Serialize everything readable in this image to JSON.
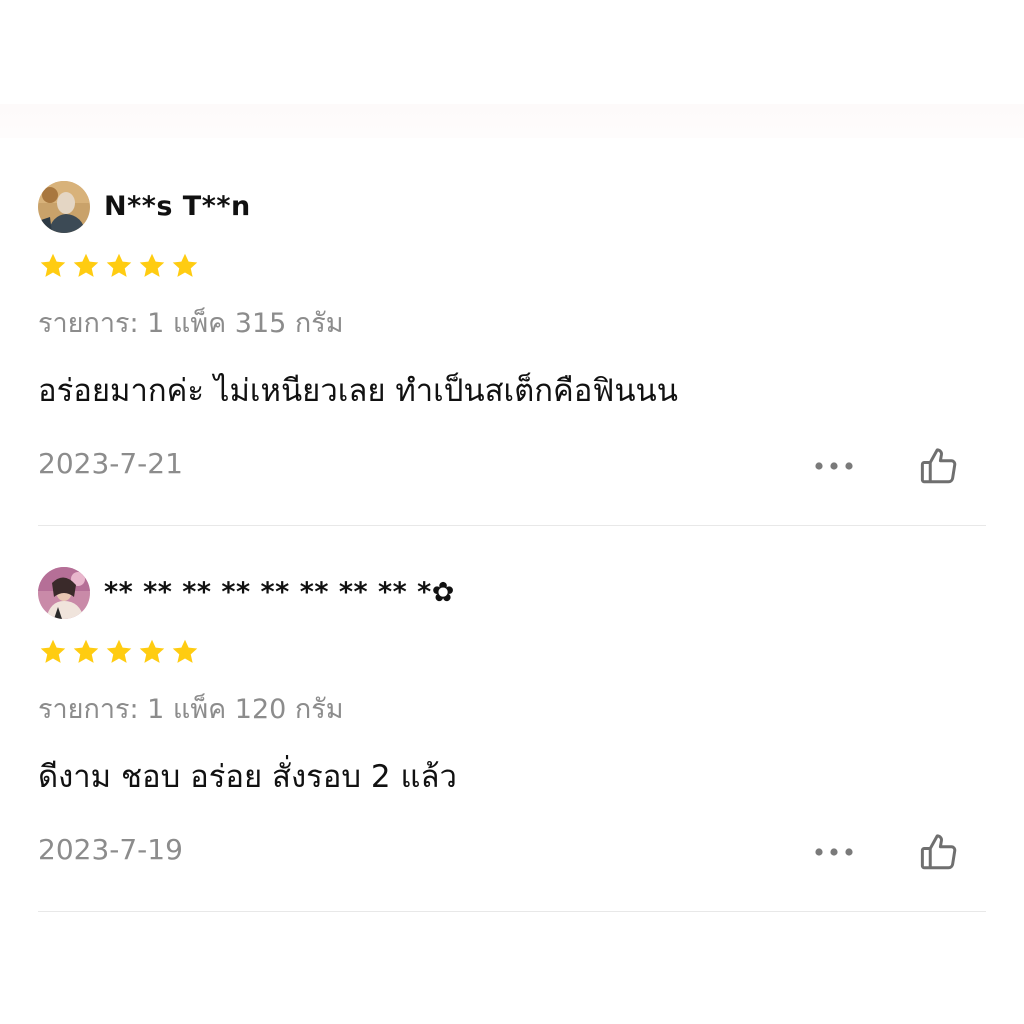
{
  "colors": {
    "star": "#FFCC11",
    "primary_text": "#111111",
    "secondary_text": "#8C8C8C",
    "divider": "#E8E8E8",
    "icon": "#7A7A7A"
  },
  "reviews": [
    {
      "username": "N**s T**n",
      "rating": 5,
      "variant": "รายการ: 1 แพ็ค 315 กรัม",
      "comment": "อร่อยมากค่ะ ไม่เหนียวเลย ทำเป็นสเต็กคือฟินนน",
      "date": "2023-7-21",
      "more_icon": "more-dots-icon",
      "like_icon": "thumbs-up-icon"
    },
    {
      "username": "** ** ** ** ** ** ** ** *✿",
      "rating": 5,
      "variant": "รายการ: 1 แพ็ค 120 กรัม",
      "comment": "ดีงาม ชอบ อร่อย สั่งรอบ 2 แล้ว",
      "date": "2023-7-19",
      "more_icon": "more-dots-icon",
      "like_icon": "thumbs-up-icon"
    }
  ]
}
